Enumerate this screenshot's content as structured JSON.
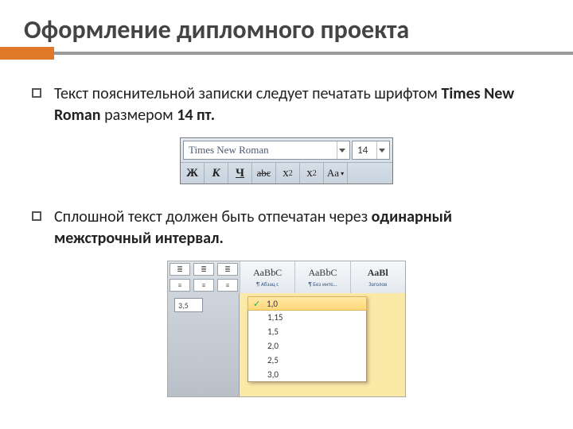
{
  "title": "Оформление дипломного проекта",
  "bullets": {
    "b1_prefix": "Текст пояснительной записки следует печатать шрифтом ",
    "b1_font": "Times New Roman",
    "b1_mid": " размером ",
    "b1_size": "14 пт.",
    "b2_prefix": "Сплошной текст должен быть отпечатан через ",
    "b2_bold": "одинарный межстрочный интервал."
  },
  "font_toolbar": {
    "font_name": "Times New Roman",
    "font_size": "14",
    "btn_bold": "Ж",
    "btn_italic": "К",
    "btn_underline": "Ч",
    "btn_strike": "abc",
    "btn_sub_base": "x",
    "btn_sub_sub": "2",
    "btn_sup_base": "x",
    "btn_sup_sup": "2",
    "btn_case": "Aa"
  },
  "styles_toolbar": {
    "indent_value": "3,5",
    "sample_text": "АаВbС",
    "sample_bold": "АаВl",
    "labels": {
      "s1": "¶ Абзац с",
      "s2": "¶ Без инте…",
      "s3": "Заголов"
    },
    "spacing_options": {
      "o1": "1,0",
      "o2": "1,15",
      "o3": "1,5",
      "o4": "2,0",
      "o5": "2,5",
      "o6": "3,0"
    },
    "selected_spacing": "1,0"
  }
}
